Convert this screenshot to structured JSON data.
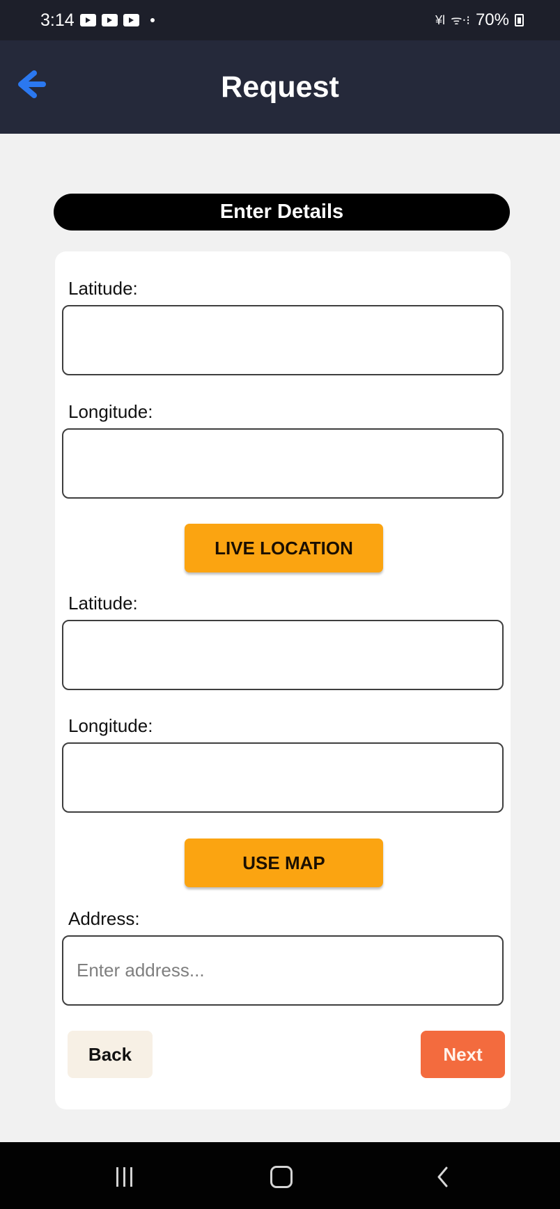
{
  "status_bar": {
    "time": "3:14",
    "mini": "¥l",
    "network": "ເ͠.͈",
    "battery": "70%"
  },
  "app_bar": {
    "title": "Request"
  },
  "form": {
    "header": "Enter Details",
    "latitude_label": "Latitude:",
    "longitude_label": "Longitude:",
    "live_location_button": "LIVE LOCATION",
    "latitude_label_2": "Latitude:",
    "longitude_label_2": "Longitude:",
    "use_map_button": "USE MAP",
    "address_label": "Address:",
    "address_placeholder": "Enter address...",
    "back_button": "Back",
    "next_button": "Next"
  },
  "colors": {
    "header_bg": "#25293a",
    "accent_blue": "#2b78f0",
    "button_orange": "#fba411",
    "next_orange": "#f36b3e",
    "back_bg": "#f7f0e5"
  },
  "icons": {
    "back": "arrow-left-icon",
    "recent": "recent-apps-icon",
    "home": "home-icon",
    "nav_back": "chevron-left-icon"
  }
}
